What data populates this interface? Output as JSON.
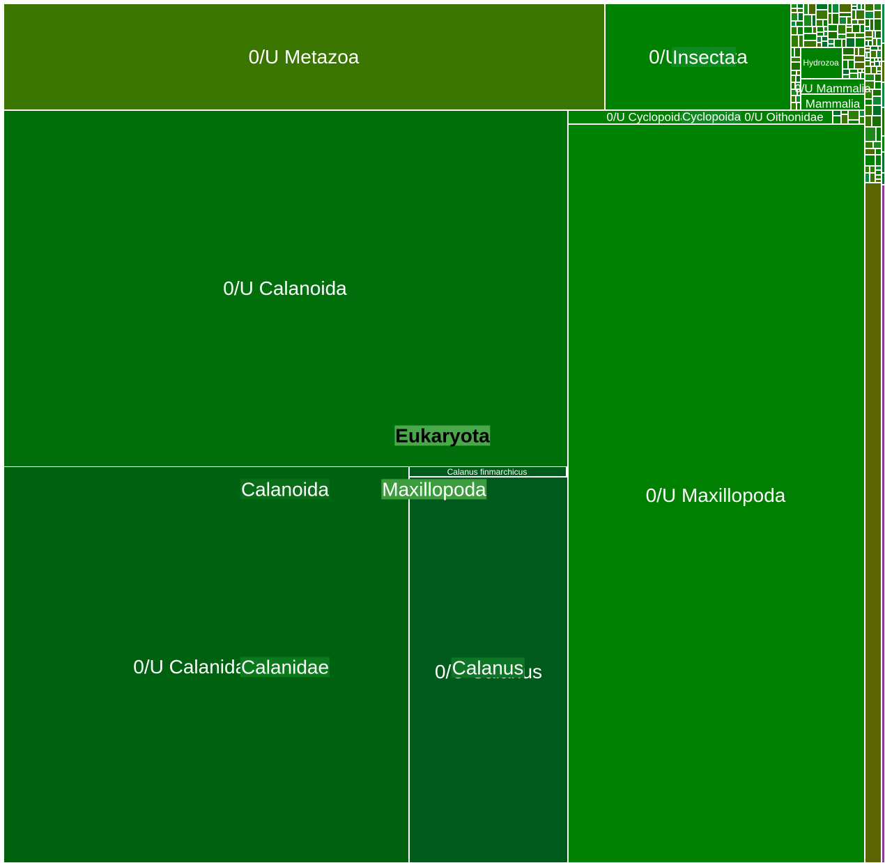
{
  "chart_data": {
    "type": "treemap",
    "title": "",
    "root": "Eukaryota",
    "group_labels": [
      {
        "id": "insecta",
        "text": "Insecta",
        "color": "#0d8a1f"
      },
      {
        "id": "cyclopoida",
        "text": "Cyclopoida",
        "color": "#0d8a1f"
      },
      {
        "id": "eukaryota",
        "text": "Eukaryota",
        "color": "#49a84a"
      },
      {
        "id": "calanoida",
        "text": "Calanoida",
        "color": "#0a6e18"
      },
      {
        "id": "maxillopoda",
        "text": "Maxillopoda",
        "color": "#3b9c3d"
      },
      {
        "id": "calanidae",
        "text": "Calanidae",
        "color": "#0b7a1c"
      },
      {
        "id": "calanus",
        "text": "Calanus",
        "color": "#0f7526"
      }
    ],
    "leaves": [
      {
        "id": "maxillopoda_u",
        "label": "0/U Maxillopoda",
        "value": 33.0,
        "color": "#008000"
      },
      {
        "id": "calanoida_u",
        "label": "0/U Calanoida",
        "value": 26.2,
        "color": "#006f0c"
      },
      {
        "id": "calanidae_u",
        "label": "0/U Calanidae",
        "value": 21.6,
        "color": "#006210"
      },
      {
        "id": "calanus_u",
        "label": "0/U Calanus",
        "value": 8.5,
        "color": "#005a1c"
      },
      {
        "id": "metazoa_u",
        "label": "0/U Metazoa",
        "value": 8.4,
        "color": "#3a7500"
      },
      {
        "id": "insecta_u",
        "label": "0/U Insecta",
        "value": 2.7,
        "color": "#008000"
      },
      {
        "id": "other_dark",
        "label": "",
        "value": 0.9,
        "color": "#5a6400"
      },
      {
        "id": "cyclopoida_u",
        "label": "0/U Cyclopoida",
        "value": 0.7,
        "color": "#008000"
      },
      {
        "id": "oithonidae_u",
        "label": "0/U Oithonidae",
        "value": 0.4,
        "color": "#008000"
      },
      {
        "id": "calanus_finmarchicus",
        "label": "Calanus finmarchicus",
        "value": 0.2,
        "color": "#005a1c"
      },
      {
        "id": "hydrozoa",
        "label": "Hydrozoa",
        "value": 0.3,
        "color": "#008000"
      },
      {
        "id": "mammalia_u",
        "label": "0/U Mammalia",
        "value": 0.2,
        "color": "#008000"
      },
      {
        "id": "mammalia",
        "label": "Mammalia",
        "value": 0.1,
        "color": "#008000"
      },
      {
        "id": "small_leaves",
        "label": "",
        "value": 1.2,
        "color": "#1e8a1e"
      }
    ]
  }
}
